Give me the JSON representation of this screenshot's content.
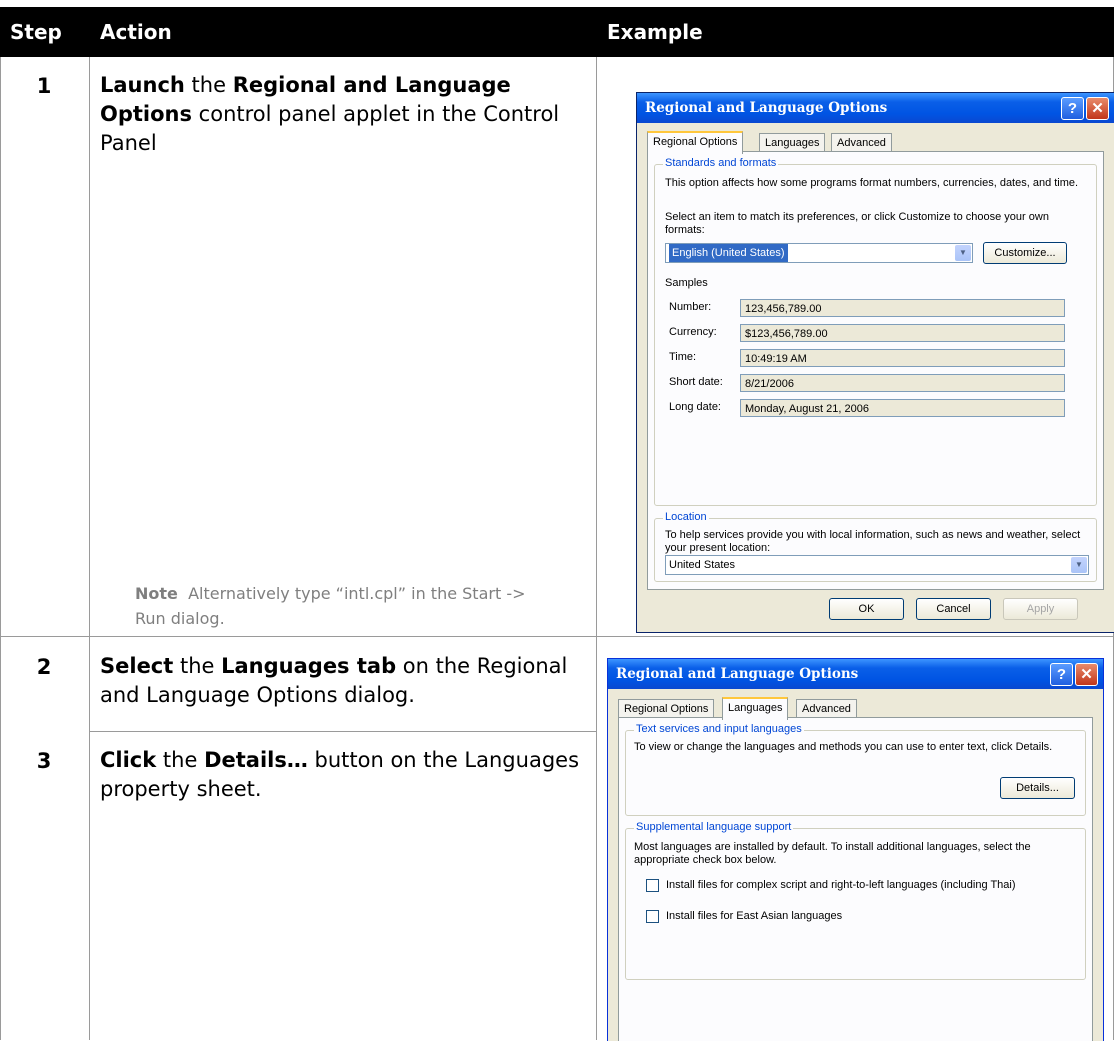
{
  "table": {
    "headers": {
      "step": "Step",
      "action": "Action",
      "example": "Example"
    },
    "rows": [
      {
        "step": "1",
        "action": [
          {
            "text": "Launch",
            "bold": true
          },
          {
            "text": " the ",
            "bold": false
          },
          {
            "text": "Regional and Language Options",
            "bold": true
          },
          {
            "text": " control panel applet in the Control Panel",
            "bold": false
          }
        ],
        "note_label": "Note",
        "note_text": "Alternatively type “intl.cpl” in the Start -> Run dialog."
      },
      {
        "step": "2",
        "action": [
          {
            "text": "Select",
            "bold": true
          },
          {
            "text": " the ",
            "bold": false
          },
          {
            "text": "Languages tab",
            "bold": true
          },
          {
            "text": " on the Regional and Language Options dialog.",
            "bold": false
          }
        ]
      },
      {
        "step": "3",
        "action": [
          {
            "text": "Click",
            "bold": true
          },
          {
            "text": " the ",
            "bold": false
          },
          {
            "text": "Details…",
            "bold": true
          },
          {
            "text": " button on the Languages property sheet.",
            "bold": false
          }
        ]
      }
    ]
  },
  "dialog1": {
    "title": "Regional and Language Options",
    "help_glyph": "?",
    "close_glyph": "✕",
    "tabs": [
      "Regional Options",
      "Languages",
      "Advanced"
    ],
    "active_tab": "Regional Options",
    "standards_group": "Standards and formats",
    "standards_desc": "This option affects how some programs format numbers, currencies, dates, and time.",
    "select_prompt": "Select an item to match its preferences, or click Customize to choose your own formats:",
    "format_value": "English (United States)",
    "customize_button": "Customize...",
    "samples_label": "Samples",
    "samples": [
      {
        "label": "Number:",
        "value": "123,456,789.00"
      },
      {
        "label": "Currency:",
        "value": "$123,456,789.00"
      },
      {
        "label": "Time:",
        "value": "10:49:19 AM"
      },
      {
        "label": "Short date:",
        "value": "8/21/2006"
      },
      {
        "label": "Long date:",
        "value": "Monday, August 21, 2006"
      }
    ],
    "location_group": "Location",
    "location_desc": "To help services provide you with local information, such as news and weather, select your present location:",
    "location_value": "United States",
    "ok_button": "OK",
    "cancel_button": "Cancel",
    "apply_button": "Apply"
  },
  "dialog2": {
    "title": "Regional and Language Options",
    "help_glyph": "?",
    "close_glyph": "✕",
    "tabs": [
      "Regional Options",
      "Languages",
      "Advanced"
    ],
    "active_tab": "Languages",
    "text_services_group": "Text services and input languages",
    "text_services_desc": "To view or change the languages and methods you can use to enter text, click Details.",
    "details_button": "Details...",
    "supplemental_group": "Supplemental language support",
    "supplemental_desc": "Most languages are installed by default. To install additional languages, select the appropriate check box below.",
    "checkbox_complex": "Install files for complex script and right-to-left languages (including Thai)",
    "checkbox_east_asian": "Install files for East Asian languages"
  },
  "colors": {
    "header_bg": "#000000",
    "title_bar": "#0054e3",
    "dialog_face": "#ece9d8",
    "group_title": "#0046d5",
    "selection": "#316ac5",
    "note_text": "#7f7f7f"
  }
}
